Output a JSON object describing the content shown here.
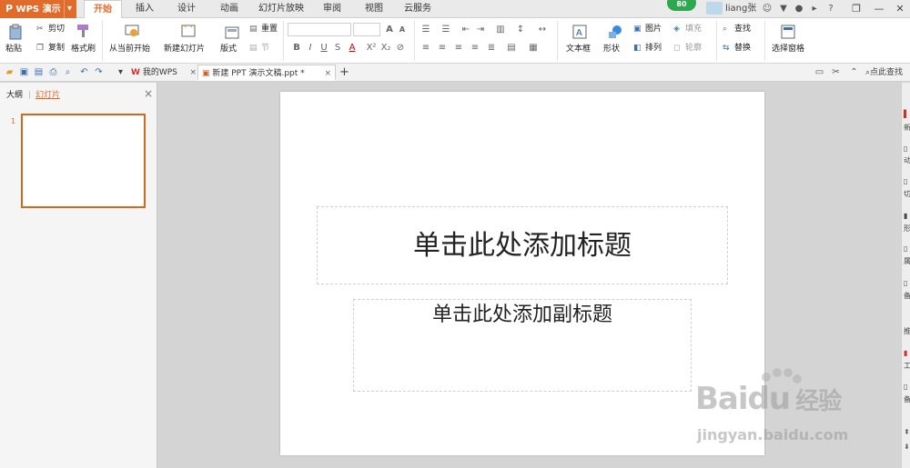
{
  "app": {
    "name": "WPS 演示",
    "dropdown": "▾"
  },
  "menu_tabs": [
    "开始",
    "插入",
    "设计",
    "动画",
    "幻灯片放映",
    "审阅",
    "视图",
    "云服务"
  ],
  "active_menu_tab": "开始",
  "update_badge": "80",
  "user": {
    "name": "liang张"
  },
  "window_controls": {
    "help": "?",
    "minimize": "—",
    "restore": "❐",
    "close": "✕"
  },
  "ribbon": {
    "paste": "粘贴",
    "cut": "剪切",
    "copy": "复制",
    "format_painter": "格式刷",
    "from_current": "从当前开始",
    "new_slide": "新建幻灯片",
    "layout": "版式",
    "reset": "重置",
    "section": "节",
    "font_name": "",
    "font_size": "",
    "textbox": "文本框",
    "shape": "形状",
    "picture": "图片",
    "fill": "填充",
    "arrange": "排列",
    "outline": "轮廓",
    "find": "查找",
    "replace": "替换",
    "selection_pane": "选择窗格"
  },
  "doc_tabs": [
    {
      "label": "我的WPS",
      "active": false
    },
    {
      "label": "新建 PPT 演示文稿.ppt *",
      "active": true
    }
  ],
  "add_tab": "+",
  "search_hint": "点此查找",
  "left_panel": {
    "tab_outline": "大纲",
    "tab_slides": "幻灯片",
    "active_tab": "幻灯片",
    "slide_number": "1"
  },
  "slide": {
    "title_placeholder": "单击此处添加标题",
    "subtitle_placeholder": "单击此处添加副标题"
  },
  "right_sidebar_labels": [
    "新",
    "动",
    "切",
    "形",
    "属",
    "备",
    "推",
    "工",
    "备"
  ],
  "watermark": {
    "brand": "Baidu",
    "brand_cn": "经验",
    "url": "jingyan.baidu.com"
  },
  "colors": {
    "accent": "#e06b2a",
    "thumb_border": "#d2691e"
  }
}
